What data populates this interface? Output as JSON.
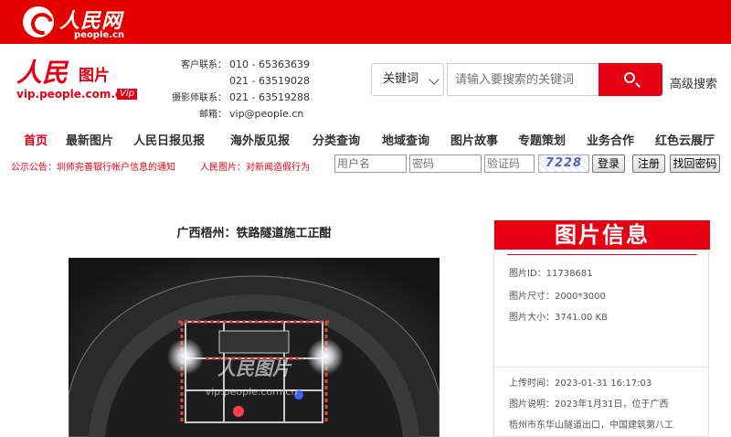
{
  "top_banner": {
    "logo_cn": "人民网",
    "logo_en": "people.cn"
  },
  "brand": {
    "cn_main": "人民",
    "cn_sub": "图片",
    "domain": "vip.people.com.cn",
    "badge": "Vip"
  },
  "contacts": [
    {
      "label": "客户联系：",
      "value": "010 - 65363639"
    },
    {
      "label": "",
      "value": "021 - 63519028"
    },
    {
      "label": "摄影师联系：",
      "value": "021 - 63519288"
    },
    {
      "label": "邮箱：",
      "value": "vip@people.cn"
    }
  ],
  "search": {
    "select_value": "关键词",
    "placeholder": "请输入要搜索的关键词",
    "advanced_label": "高级搜索"
  },
  "nav": [
    "首页",
    "最新图片",
    "人民日报见报",
    "海外版见报",
    "分类查询",
    "地域查询",
    "图片故事",
    "专题策划",
    "业务合作",
    "红色云展厅"
  ],
  "notices": [
    {
      "prefix": "公示公告：",
      "text": "圳师完善银行帐户信息的通知"
    },
    {
      "prefix": "人民图片：",
      "text": "对新闻造假行为"
    }
  ],
  "login": {
    "username_placeholder": "用户名",
    "password_placeholder": "密码",
    "captcha_placeholder": "验证码",
    "captcha_text": "7228",
    "login_button": "登录",
    "register_button": "注册",
    "recover_button": "找回密码"
  },
  "article": {
    "title": "广西梧州：铁路隧道施工正酣",
    "watermark_cn": "人民图片",
    "watermark_en": "vip.people.com.cn"
  },
  "info": {
    "header": "图片信息",
    "rows": [
      {
        "label": "图片ID：",
        "value": "11738681"
      },
      {
        "label": "图片尺寸：",
        "value": "2000*3000"
      },
      {
        "label": "图片大小：",
        "value": "3741.00 KB"
      },
      {
        "label": "上传时间：",
        "value": "2023-01-31 16:17:03"
      },
      {
        "label": "图片说明：",
        "value": "2023年1月31日，位于广西"
      },
      {
        "label": "",
        "value": "梧州市东华山隧道出口，中国建筑第八工"
      }
    ]
  },
  "colors": {
    "brand_red": "#e60012",
    "banner_red": "#e50000"
  }
}
